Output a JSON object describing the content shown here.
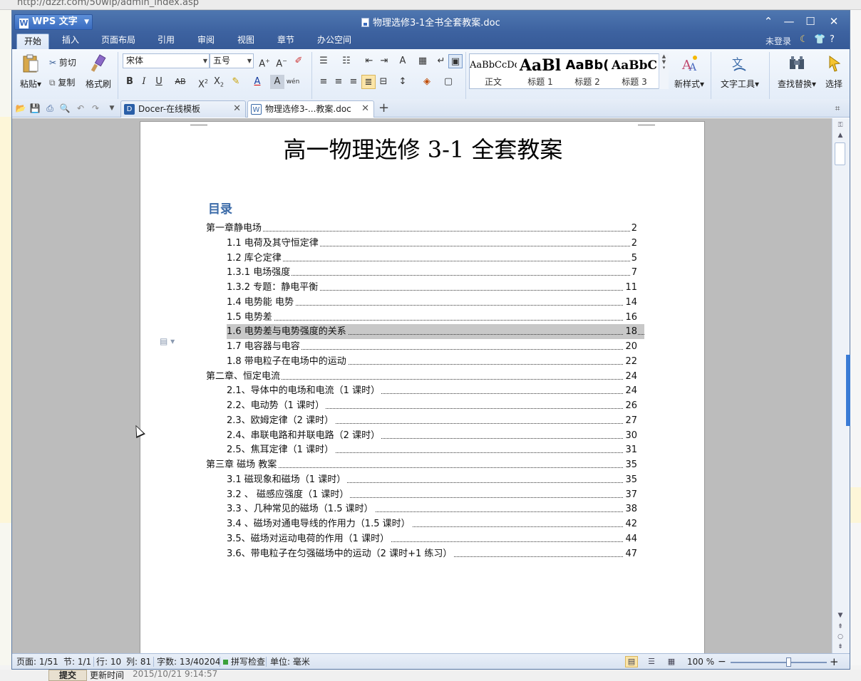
{
  "background": {
    "url": "http://dzzf.com/50wip/admin_index.asp",
    "submit_label": "提交",
    "update_label": "更新时间",
    "update_value": "2015/10/21 9:14:57"
  },
  "window": {
    "app_name": "WPS 文字",
    "doc_title": "物理选修3-1全书全套教案.doc"
  },
  "menu": {
    "tabs": [
      "开始",
      "插入",
      "页面布局",
      "引用",
      "审阅",
      "视图",
      "章节",
      "办公空间"
    ],
    "active": 0,
    "login_status": "未登录",
    "help": "?"
  },
  "ribbon": {
    "paste": "粘贴",
    "cut": "剪切",
    "copy": "复制",
    "format_painter": "格式刷",
    "font_name": "宋体",
    "font_size": "五号",
    "styles": [
      {
        "preview": "AaBbCcDd",
        "label": "正文"
      },
      {
        "preview": "AaBl",
        "label": "标题 1"
      },
      {
        "preview": "AaBb(",
        "label": "标题 2"
      },
      {
        "preview": "AaBbC",
        "label": "标题 3"
      }
    ],
    "new_style": "新样式",
    "text_tools": "文字工具",
    "find_replace": "查找替换",
    "select": "选择"
  },
  "tabs": [
    {
      "label": "Docer-在线模板",
      "icon": "docer-icon"
    },
    {
      "label": "物理选修3-...教案.doc",
      "icon": "word-doc-icon"
    }
  ],
  "document": {
    "title": "高一物理选修 3-1 全套教案",
    "toc_heading": "目录",
    "toc": [
      {
        "text": "第一章静电场",
        "page": "2",
        "level": 0
      },
      {
        "text": "1.1 电荷及其守恒定律",
        "page": "2",
        "level": 1
      },
      {
        "text": "1.2 库仑定律",
        "page": "5",
        "level": 1
      },
      {
        "text": "1.3.1 电场强度",
        "page": "7",
        "level": 1
      },
      {
        "text": "1.3.2 专题：静电平衡",
        "page": "11",
        "level": 1
      },
      {
        "text": "1.4 电势能  电势",
        "page": "14",
        "level": 1
      },
      {
        "text": "1.5 电势差",
        "page": "16",
        "level": 1
      },
      {
        "text": "1.6 电势差与电势强度的关系",
        "page": "18",
        "level": 1,
        "highlight": true
      },
      {
        "text": "1.7 电容器与电容",
        "page": "20",
        "level": 1
      },
      {
        "text": "1.8 带电粒子在电场中的运动",
        "page": "22",
        "level": 1
      },
      {
        "text": "第二章、恒定电流",
        "page": "24",
        "level": 0
      },
      {
        "text": "2.1、导体中的电场和电流（1 课时）",
        "page": "24",
        "level": 1
      },
      {
        "text": "2.2、电动势（1 课时）",
        "page": "26",
        "level": 1
      },
      {
        "text": "2.3、欧姆定律（2 课时）",
        "page": "27",
        "level": 1
      },
      {
        "text": "2.4、串联电路和并联电路（2 课时）",
        "page": "30",
        "level": 1
      },
      {
        "text": "2.5、焦耳定律（1 课时）",
        "page": "31",
        "level": 1
      },
      {
        "text": "第三章 磁场 教案",
        "page": "35",
        "level": 0
      },
      {
        "text": "3.1  磁现象和磁场（1 课时）",
        "page": "35",
        "level": 1
      },
      {
        "text": "3.2 、 磁感应强度（1 课时）",
        "page": "37",
        "level": 1
      },
      {
        "text": "3.3 、几种常见的磁场（1.5 课时）",
        "page": "38",
        "level": 1
      },
      {
        "text": "3.4 、磁场对通电导线的作用力（1.5 课时）",
        "page": "42",
        "level": 1
      },
      {
        "text": "3.5、磁场对运动电荷的作用（1 课时）",
        "page": "44",
        "level": 1
      },
      {
        "text": "3.6、带电粒子在匀强磁场中的运动（2 课时+1 练习）",
        "page": "47",
        "level": 1
      }
    ]
  },
  "status": {
    "page": "页面: 1/51",
    "section": "节: 1/1",
    "row": "行: 10",
    "col": "列: 81",
    "wordcount": "字数: 13/40204",
    "spellcheck": "拼写检查",
    "unit": "单位: 毫米",
    "zoom": "100 %",
    "zoom_level": 0.5
  }
}
